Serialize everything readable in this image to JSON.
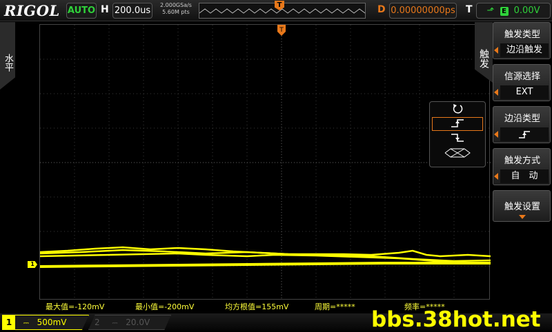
{
  "header": {
    "logo": "RIGOL",
    "run_status": "AUTO",
    "horizontal_label": "H",
    "timebase": "200.0us",
    "sample_rate": "2.000GSa/s",
    "memory_depth": "5.60M pts",
    "trigger_marker": "T",
    "delay_label": "D",
    "delay_value": "0.00000000ps",
    "trigger_label": "T",
    "trigger_level": "0.00V",
    "trigger_source_glyph": "E"
  },
  "left_tab": {
    "label": "水平"
  },
  "screen": {
    "ch1_marker": "1"
  },
  "measurements": [
    {
      "text": "最大值=-120mV"
    },
    {
      "text": "最小值=-200mV"
    },
    {
      "text": "均方根值=155mV"
    },
    {
      "text": "周期=*****"
    },
    {
      "text": "频率=*****"
    }
  ],
  "channels": {
    "ch1": {
      "number": "1",
      "coupling": "⎓",
      "scale": "500mV"
    },
    "ch2": {
      "number": "2",
      "coupling": "⎓",
      "scale": "20.0V"
    }
  },
  "watermark": "bbs.38hot.net",
  "trigger_menu": {
    "header": "触发",
    "items": [
      {
        "title": "触发类型",
        "value": "边沿触发"
      },
      {
        "title": "信源选择",
        "value": "EXT"
      },
      {
        "title": "边沿类型",
        "value": "rising-edge"
      },
      {
        "title": "触发方式",
        "value": "自　动"
      },
      {
        "title": "触发设置",
        "value": ""
      }
    ]
  },
  "slope_popup": {
    "options": [
      "either-edge-icon",
      "rising-edge-icon",
      "falling-edge-icon",
      "alternating-edge-icon"
    ],
    "selected_index": 1
  },
  "colors": {
    "ch1": "#ffff00",
    "accent": "#e8781a",
    "status": "#2fd13a"
  }
}
